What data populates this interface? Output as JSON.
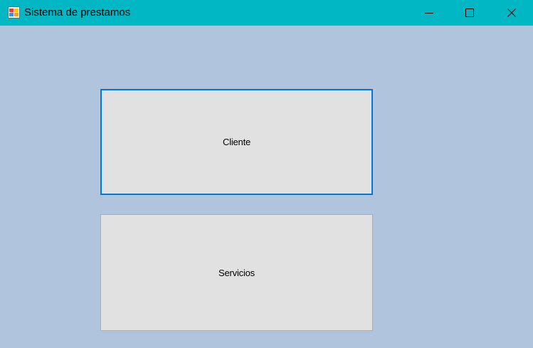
{
  "window": {
    "title": "Sistema de prestamos",
    "icon": "windows-form-icon",
    "controls": {
      "minimize_icon": "minimize-icon",
      "maximize_icon": "maximize-icon",
      "close_icon": "close-icon"
    },
    "colors": {
      "titlebar": "#00b7c3",
      "background": "#b0c4de",
      "button_face": "#e1e1e1",
      "focus_border": "#0078d7"
    }
  },
  "buttons": {
    "cliente_label": "Cliente",
    "servicios_label": "Servicios"
  }
}
